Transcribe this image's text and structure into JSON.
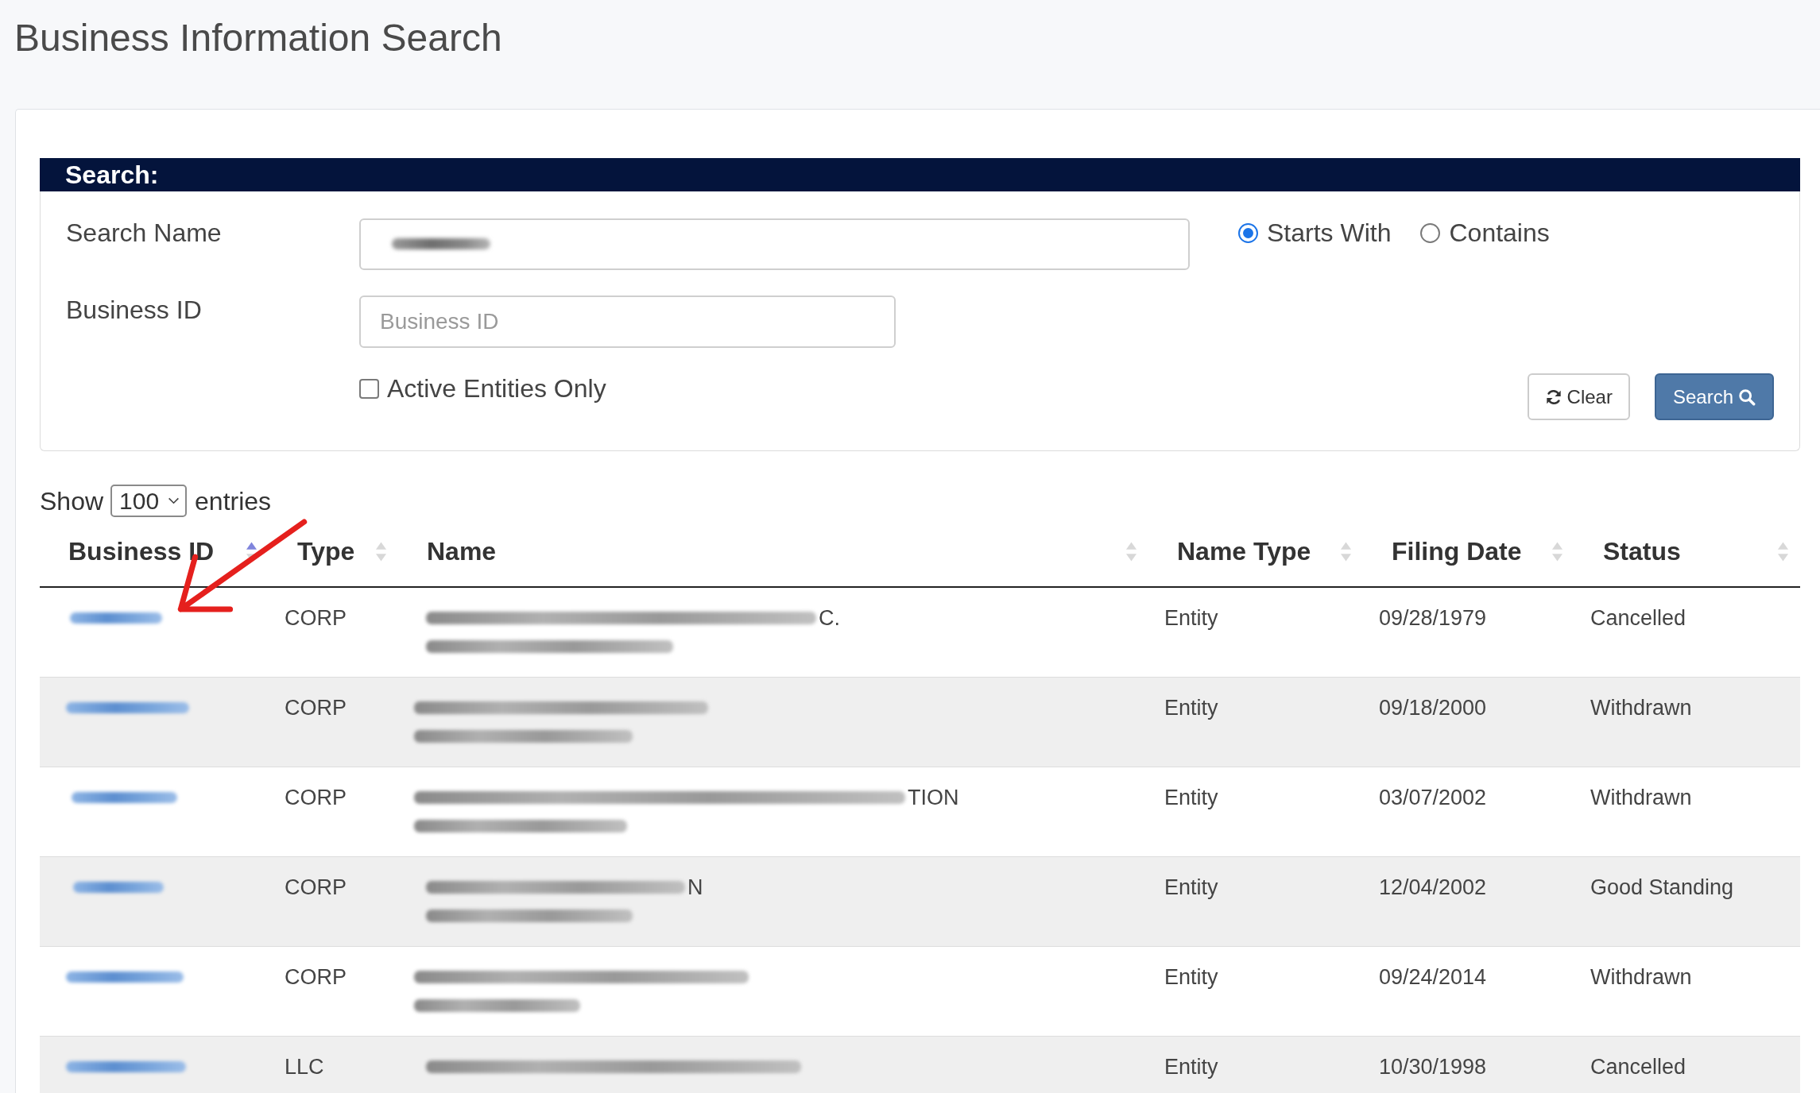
{
  "page": {
    "title": "Business Information Search"
  },
  "search_panel": {
    "header": "Search:",
    "fields": [
      {
        "label": "Search Name",
        "redacted_value": true
      },
      {
        "label": "Business ID",
        "placeholder": "Business ID"
      }
    ],
    "match_options": [
      {
        "label": "Starts With",
        "selected": true
      },
      {
        "label": "Contains",
        "selected": false
      }
    ],
    "active_only": {
      "label": "Active Entities Only",
      "checked": false
    },
    "buttons": [
      {
        "label": "Clear",
        "kind": "reset"
      },
      {
        "label": "Search",
        "kind": "search"
      }
    ]
  },
  "entries": {
    "before": "Show",
    "value": "100",
    "after": "entries"
  },
  "table": {
    "columns": [
      {
        "label": "Business ID",
        "sorted": true
      },
      {
        "label": "Type",
        "sorted": false
      },
      {
        "label": "Name",
        "sorted": false
      },
      {
        "label": "Name Type",
        "sorted": false
      },
      {
        "label": "Filing Date",
        "sorted": false
      },
      {
        "label": "Status",
        "sorted": false
      }
    ],
    "rows": [
      {
        "business_id": {
          "redacted": true
        },
        "type": "CORP",
        "name": {
          "redacted": true,
          "visible_end": "C."
        },
        "name_type": "Entity",
        "filing_date": "09/28/1979",
        "status": "Cancelled"
      },
      {
        "business_id": {
          "redacted": true
        },
        "type": "CORP",
        "name": {
          "redacted": true
        },
        "name_type": "Entity",
        "filing_date": "09/18/2000",
        "status": "Withdrawn"
      },
      {
        "business_id": {
          "redacted": true
        },
        "type": "CORP",
        "name": {
          "redacted": true,
          "visible_end": "TION"
        },
        "name_type": "Entity",
        "filing_date": "03/07/2002",
        "status": "Withdrawn"
      },
      {
        "business_id": {
          "redacted": true
        },
        "type": "CORP",
        "name": {
          "redacted": true,
          "visible_end": "N"
        },
        "name_type": "Entity",
        "filing_date": "12/04/2002",
        "status": "Good Standing"
      },
      {
        "business_id": {
          "redacted": true
        },
        "type": "CORP",
        "name": {
          "redacted": true
        },
        "name_type": "Entity",
        "filing_date": "09/24/2014",
        "status": "Withdrawn"
      },
      {
        "business_id": {
          "redacted": true
        },
        "type": "LLC",
        "name": {
          "redacted": true
        },
        "name_type": "Entity",
        "filing_date": "10/30/1998",
        "status": "Cancelled"
      }
    ]
  }
}
